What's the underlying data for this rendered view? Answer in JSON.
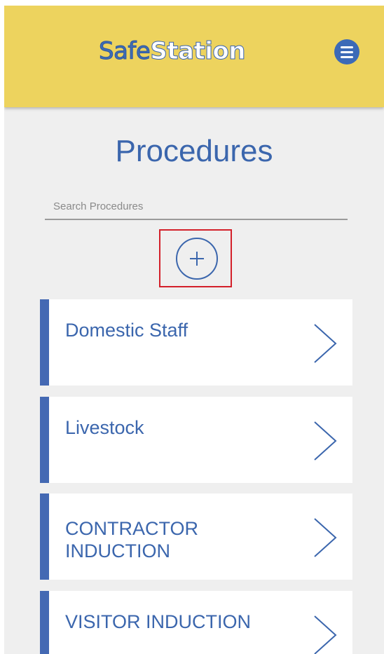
{
  "header": {
    "logo_part1": "Safe",
    "logo_part2": "Station",
    "menu_icon": "hamburger-menu-icon",
    "background_color": "#edd35e",
    "brand_color": "#3c6ab7"
  },
  "page": {
    "title": "Procedures"
  },
  "search": {
    "placeholder": "Search Procedures",
    "value": ""
  },
  "add_button": {
    "icon": "plus-circle-icon",
    "highlight_color": "#d3202a"
  },
  "procedures": [
    {
      "label": "Domestic Staff",
      "icon": "chevron-right-icon"
    },
    {
      "label": "Livestock",
      "icon": "chevron-right-icon"
    },
    {
      "label": "CONTRACTOR INDUCTION",
      "icon": "chevron-right-icon"
    },
    {
      "label": "VISITOR INDUCTION",
      "icon": "chevron-right-icon"
    }
  ]
}
